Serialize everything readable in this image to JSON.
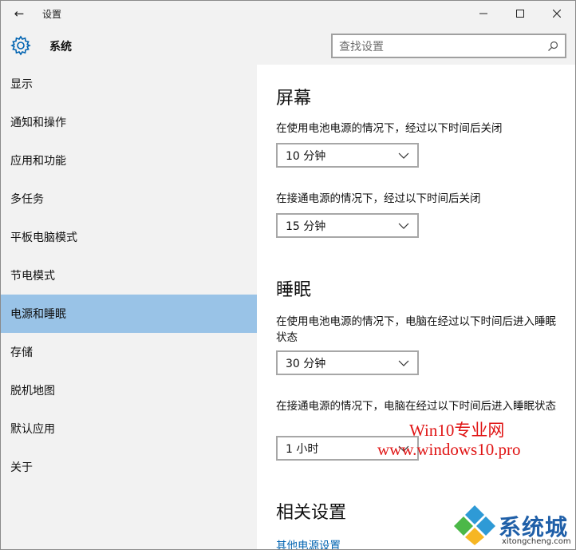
{
  "window": {
    "title": "设置",
    "back_glyph": "←",
    "minimize_glyph": "—",
    "maximize_glyph": "☐",
    "close_glyph": "✕"
  },
  "header": {
    "section": "系统",
    "search_placeholder": "查找设置"
  },
  "sidebar": {
    "items": [
      {
        "label": "显示"
      },
      {
        "label": "通知和操作"
      },
      {
        "label": "应用和功能"
      },
      {
        "label": "多任务"
      },
      {
        "label": "平板电脑模式"
      },
      {
        "label": "节电模式"
      },
      {
        "label": "电源和睡眠"
      },
      {
        "label": "存储"
      },
      {
        "label": "脱机地图"
      },
      {
        "label": "默认应用"
      },
      {
        "label": "关于"
      }
    ],
    "active_index": 6
  },
  "screen": {
    "title": "屏幕",
    "battery_label": "在使用电池电源的情况下，经过以下时间后关闭",
    "battery_value": "10 分钟",
    "plugged_label": "在接通电源的情况下，经过以下时间后关闭",
    "plugged_value": "15 分钟"
  },
  "sleep": {
    "title": "睡眠",
    "battery_label": "在使用电池电源的情况下，电脑在经过以下时间后进入睡眠状态",
    "battery_value": "30 分钟",
    "plugged_label": "在接通电源的情况下，电脑在经过以下时间后进入睡眠状态",
    "plugged_value": "1 小时"
  },
  "related": {
    "title": "相关设置",
    "link": "其他电源设置"
  },
  "watermark": {
    "line1": "Win10专业网",
    "line2": "www.windows10.pro",
    "brand": "系统城",
    "url": "xitongcheng.com"
  },
  "colors": {
    "accent": "#0063b1",
    "active_nav": "#99c3e7",
    "pane_bg": "#f2f2f2"
  }
}
